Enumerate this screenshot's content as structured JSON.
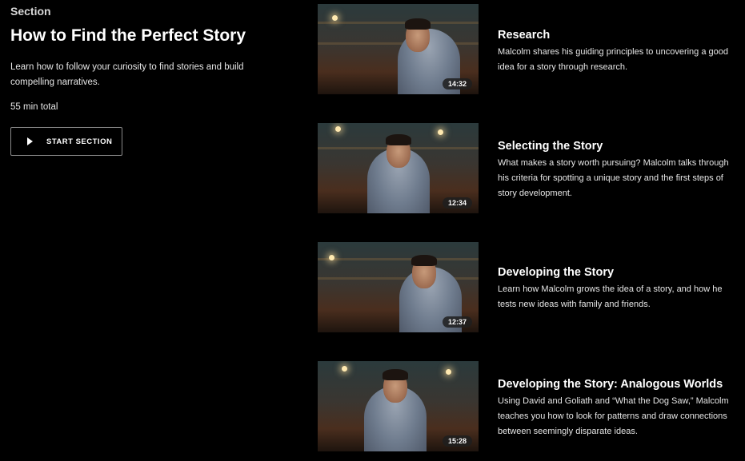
{
  "section": {
    "eyebrow": "Section",
    "title": "How to Find the Perfect Story",
    "description": "Learn how to follow your curiosity to find stories and build compelling narratives.",
    "total": "55 min total",
    "start_button": "START SECTION"
  },
  "lessons": [
    {
      "title": "Research",
      "description": "Malcolm shares his guiding principles to uncovering a good idea for a story through research.",
      "duration": "14:32"
    },
    {
      "title": "Selecting the Story",
      "description": "What makes a story worth pursuing? Malcolm talks through his criteria for spotting a unique story and the first steps of story development.",
      "duration": "12:34"
    },
    {
      "title": "Developing the Story",
      "description": "Learn how Malcolm grows the idea of a story, and how he tests new ideas with family and friends.",
      "duration": "12:37"
    },
    {
      "title": "Developing the Story: Analogous Worlds",
      "description": "Using David and Goliath and “What the Dog Saw,” Malcolm teaches you how to look for patterns and draw connections between seemingly disparate ideas.",
      "duration": "15:28"
    }
  ],
  "icons": {
    "start_button_icon": "play-icon"
  },
  "colors": {
    "background": "#000000",
    "text": "#ffffff",
    "muted_text": "#e6e6e6",
    "button_border": "#8a8a8a"
  }
}
